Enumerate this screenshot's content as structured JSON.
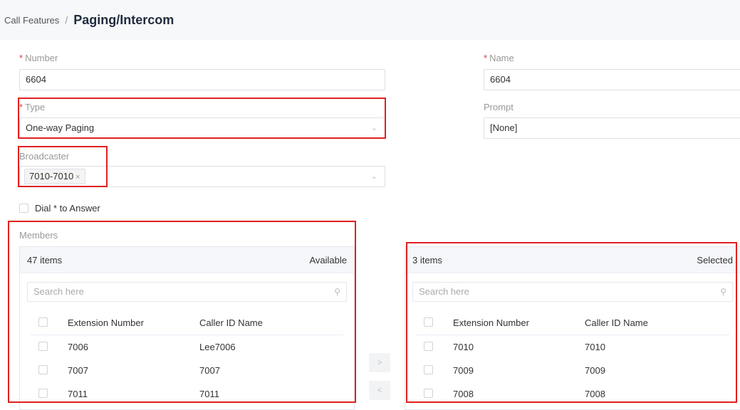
{
  "breadcrumb": {
    "parent": "Call Features",
    "separator": "/",
    "current": "Paging/Intercom"
  },
  "form": {
    "number": {
      "label": "Number",
      "required_mark": "*",
      "value": "6604"
    },
    "name": {
      "label": "Name",
      "required_mark": "*",
      "value": "6604"
    },
    "type": {
      "label": "Type",
      "required_mark": "*",
      "value": "One-way Paging"
    },
    "prompt": {
      "label": "Prompt",
      "value": "[None]"
    },
    "broadcaster": {
      "label": "Broadcaster",
      "tags": [
        "7010-7010"
      ],
      "tag_close": "×"
    },
    "dial_to_answer": {
      "label": "Dial * to Answer",
      "checked": false
    }
  },
  "members": {
    "label": "Members",
    "available": {
      "count_text": "47 items",
      "title": "Available",
      "search_placeholder": "Search here",
      "columns": [
        "Extension Number",
        "Caller ID Name"
      ],
      "rows": [
        {
          "ext": "7006",
          "name": "Lee7006"
        },
        {
          "ext": "7007",
          "name": "7007"
        },
        {
          "ext": "7011",
          "name": "7011"
        }
      ]
    },
    "selected": {
      "count_text": "3 items",
      "title": "Selected",
      "search_placeholder": "Search here",
      "columns": [
        "Extension Number",
        "Caller ID Name"
      ],
      "rows": [
        {
          "ext": "7010",
          "name": "7010"
        },
        {
          "ext": "7009",
          "name": "7009"
        },
        {
          "ext": "7008",
          "name": "7008"
        }
      ]
    },
    "move_right_label": ">",
    "move_left_label": "<"
  },
  "icons": {
    "chevron": "chevron-down-icon",
    "search": "search-icon"
  },
  "colors": {
    "highlight": "#e02020",
    "required": "#e53935",
    "header_bg": "#f7f8fa"
  }
}
